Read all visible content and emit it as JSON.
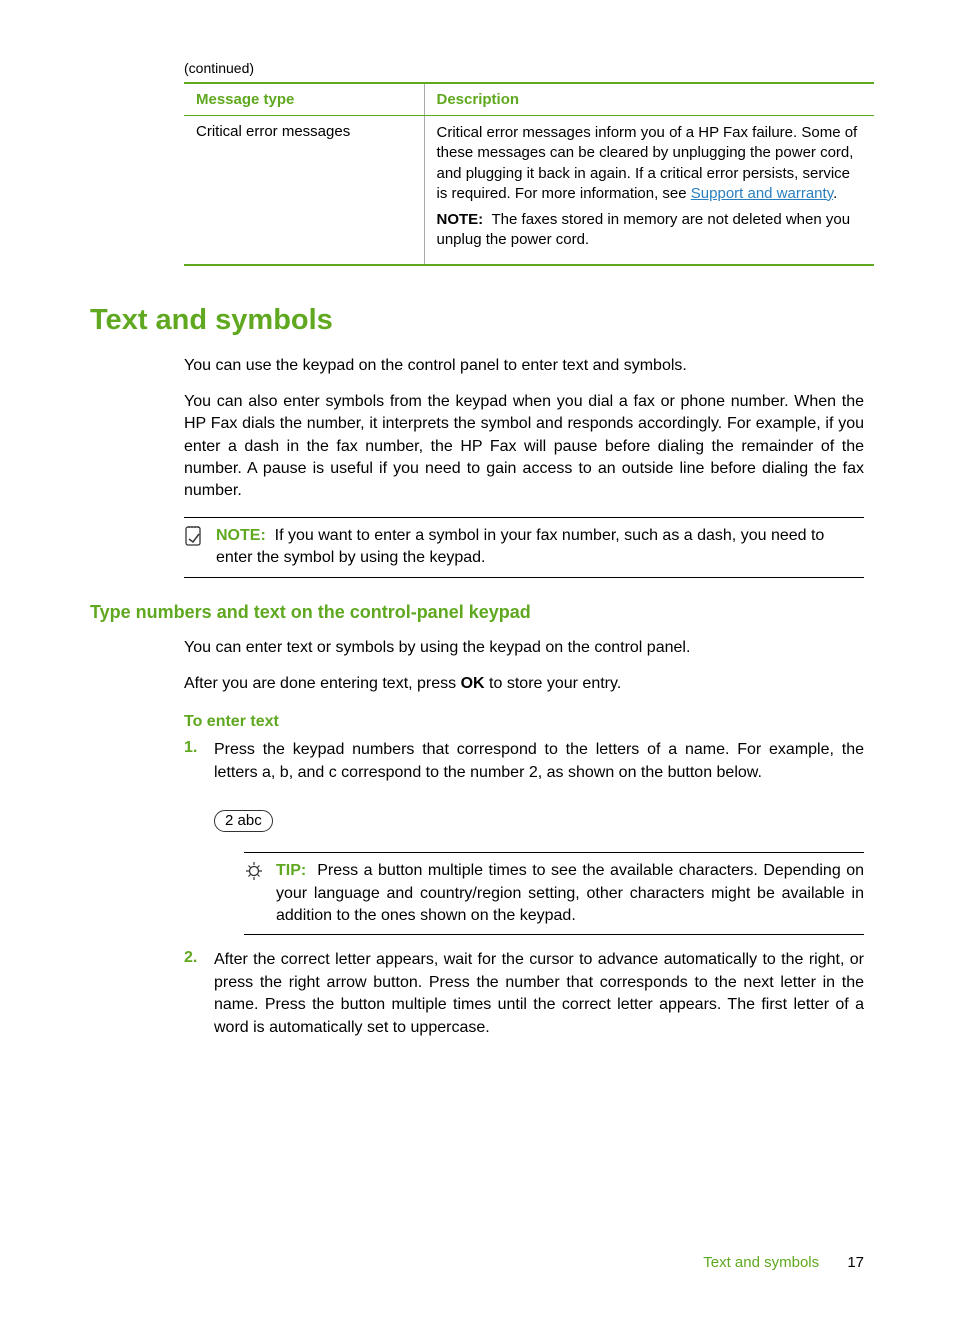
{
  "continued": "(continued)",
  "table": {
    "header_col1": "Message type",
    "header_col2": "Description",
    "row_col1": "Critical error messages",
    "row_desc_main": "Critical error messages inform you of a HP Fax failure. Some of these messages can be cleared by unplugging the power cord, and plugging it back in again. If a critical error persists, service is required. For more information, see ",
    "row_desc_link": "Support and warranty",
    "row_desc_period": ".",
    "row_note_label": "NOTE:",
    "row_note_text": "The faxes stored in memory are not deleted when you unplug the power cord."
  },
  "h1": "Text and symbols",
  "para1": "You can use the keypad on the control panel to enter text and symbols.",
  "para2": "You can also enter symbols from the keypad when you dial a fax or phone number. When the HP Fax dials the number, it interprets the symbol and responds accordingly. For example, if you enter a dash in the fax number, the HP Fax will pause before dialing the remainder of the number. A pause is useful if you need to gain access to an outside line before dialing the fax number.",
  "note1_label": "NOTE:",
  "note1_text": "If you want to enter a symbol in your fax number, such as a dash, you need to enter the symbol by using the keypad.",
  "h2": "Type numbers and text on the control-panel keypad",
  "para3": "You can enter text or symbols by using the keypad on the control panel.",
  "para4_pre": "After you are done entering text, press ",
  "para4_bold": "OK",
  "para4_post": " to store your entry.",
  "h3": "To enter text",
  "step1_num": "1.",
  "step1_text": "Press the keypad numbers that correspond to the letters of a name. For example, the letters a, b, and c correspond to the number 2, as shown on the button below.",
  "key_label": "2 abc",
  "tip_label": "TIP:",
  "tip_text": "Press a button multiple times to see the available characters. Depending on your language and country/region setting, other characters might be available in addition to the ones shown on the keypad.",
  "step2_num": "2.",
  "step2_text": "After the correct letter appears, wait for the cursor to advance automatically to the right, or press the right arrow button. Press the number that corresponds to the next letter in the name. Press the button multiple times until the correct letter appears. The first letter of a word is automatically set to uppercase.",
  "footer_label": "Text and symbols",
  "footer_page": "17"
}
